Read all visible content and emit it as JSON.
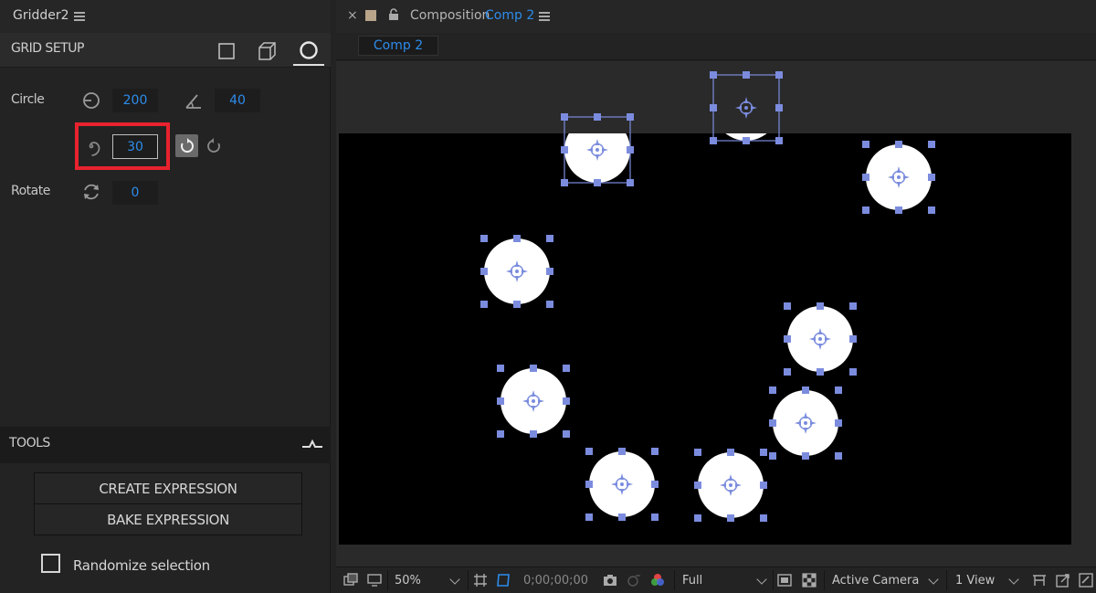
{
  "left_panel": {
    "title": "Gridder2",
    "grid_setup": {
      "title": "GRID SETUP",
      "modes": [
        "square-grid",
        "cube-grid",
        "circle-grid"
      ],
      "active_mode": "circle-grid"
    },
    "circle": {
      "label": "Circle",
      "radius": "200",
      "angle": "40",
      "spiral": "30"
    },
    "rotate": {
      "label": "Rotate",
      "value": "0"
    },
    "tools": {
      "title": "TOOLS",
      "create_label": "CREATE EXPRESSION",
      "bake_label": "BAKE EXPRESSION",
      "randomize_label": "Randomize selection",
      "randomize_checked": false
    }
  },
  "composition": {
    "close_glyph": "×",
    "prefix": "Composition",
    "name": "Comp 2",
    "subtab": "Comp 2",
    "footer": {
      "zoom": "50%",
      "timecode": "0;00;00;00",
      "resolution": "Full",
      "camera": "Active Camera",
      "views": "1 View"
    }
  },
  "colors": {
    "accent_blue": "#2d8ceb",
    "selection_handle": "#7b8cde",
    "highlight_red": "#e8222e"
  }
}
